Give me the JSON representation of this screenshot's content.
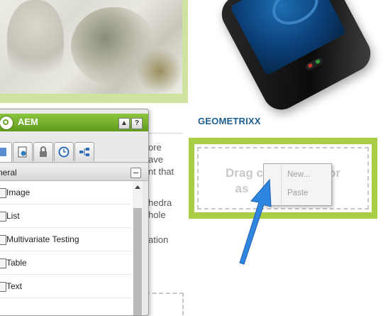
{
  "page": {
    "brand_heading": "GEOMETRIXX",
    "body_fragments": [
      "ore",
      "ave",
      "nt that",
      "hedra",
      "hole",
      "ation"
    ]
  },
  "drop_zone": {
    "text_line1": "Drag c",
    "text_line1_tail": "or",
    "text_line2": "as"
  },
  "context_menu": {
    "items": [
      {
        "label": "New...",
        "enabled": false
      },
      {
        "label": "Paste",
        "enabled": false
      }
    ]
  },
  "sidekick": {
    "title": "AEM",
    "collapse_button": "▲",
    "help_button": "?",
    "tabs": [
      {
        "icon": "components-icon",
        "active": true
      },
      {
        "icon": "page-icon",
        "active": false
      },
      {
        "icon": "lock-icon",
        "active": false
      },
      {
        "icon": "clock-icon",
        "active": false
      },
      {
        "icon": "workflow-icon",
        "active": false
      }
    ],
    "group_label": "neral",
    "components": [
      "Image",
      "List",
      "Multivariate Testing",
      "Table",
      "Text"
    ]
  },
  "colors": {
    "accent_green": "#a9cd45",
    "title_green": "#6aa52a",
    "brand_blue": "#1e5f8f",
    "arrow_blue": "#2f86e0"
  }
}
